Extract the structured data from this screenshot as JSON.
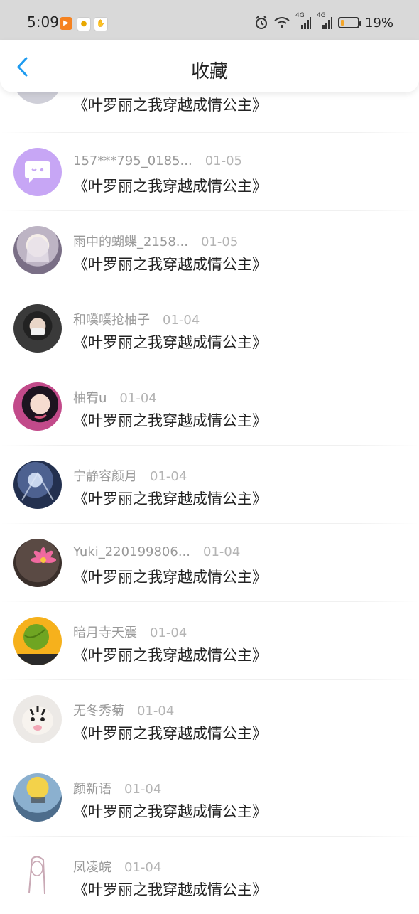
{
  "status_bar": {
    "time": "5:09",
    "network_type_1": "4G",
    "network_type_2": "4G",
    "battery_percent": 19,
    "battery_text": "19%"
  },
  "nav": {
    "title": "收藏",
    "back_icon": "chevron-left-icon",
    "accent_color": "#1e9bf0"
  },
  "items": [
    {
      "name": "",
      "date": "",
      "title": "《叶罗丽之我穿越成情公主》"
    },
    {
      "name": "157***795_0185...",
      "date": "01-05",
      "title": "《叶罗丽之我穿越成情公主》"
    },
    {
      "name": "雨中的蝴蝶_2158...",
      "date": "01-05",
      "title": "《叶罗丽之我穿越成情公主》"
    },
    {
      "name": "和噗噗抢柚子",
      "date": "01-04",
      "title": "《叶罗丽之我穿越成情公主》"
    },
    {
      "name": "柚宥u",
      "date": "01-04",
      "title": "《叶罗丽之我穿越成情公主》"
    },
    {
      "name": "宁静容颜月",
      "date": "01-04",
      "title": "《叶罗丽之我穿越成情公主》"
    },
    {
      "name": "Yuki_220199806...",
      "date": "01-04",
      "title": "《叶罗丽之我穿越成情公主》"
    },
    {
      "name": "暗月寺天震",
      "date": "01-04",
      "title": "《叶罗丽之我穿越成情公主》"
    },
    {
      "name": "无冬秀菊",
      "date": "01-04",
      "title": "《叶罗丽之我穿越成情公主》"
    },
    {
      "name": "颜新语",
      "date": "01-04",
      "title": "《叶罗丽之我穿越成情公主》"
    },
    {
      "name": "凤凌皖",
      "date": "01-04",
      "title": "《叶罗丽之我穿越成情公主》"
    }
  ]
}
